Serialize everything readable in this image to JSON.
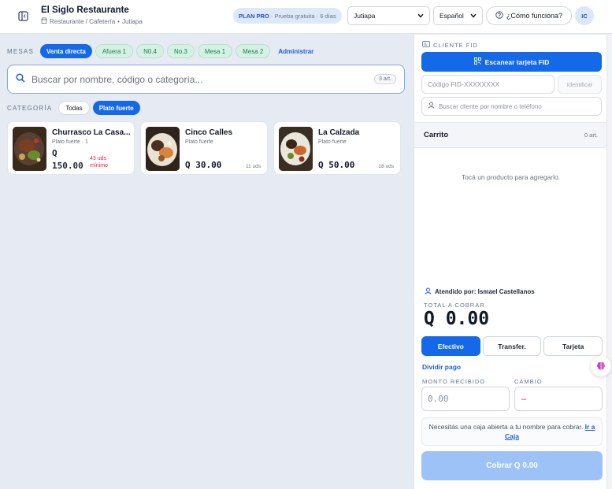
{
  "header": {
    "title": "El Siglo Restaurante",
    "subtitle_type": "Restaurante / Cafetería",
    "subtitle_sep": "•",
    "subtitle_location": "Jutiapa",
    "plan_name": "PLAN PRO",
    "plan_detail": "· Prueba gratuita · 6 días",
    "branch_select": "Jutiapa",
    "language_select": "Español",
    "help_label": "¿Cómo funciona?",
    "avatar_initials": "IC"
  },
  "mesas": {
    "label": "MESAS",
    "items": [
      {
        "label": "Venta directa",
        "style": "active"
      },
      {
        "label": "Afuera 1",
        "style": "green"
      },
      {
        "label": "N0.4",
        "style": "green"
      },
      {
        "label": "No.3",
        "style": "green"
      },
      {
        "label": "Mesa 1",
        "style": "green"
      },
      {
        "label": "Mesa 2",
        "style": "green"
      }
    ],
    "manage_link": "Administrar"
  },
  "search": {
    "placeholder": "Buscar por nombre, código o categoría...",
    "count": "3 art."
  },
  "categories": {
    "label": "CATEGORÍA",
    "items": [
      {
        "label": "Todas",
        "active": false
      },
      {
        "label": "Plato fuerte",
        "active": true
      }
    ]
  },
  "products": [
    {
      "name": "Churrasco La Casa...",
      "category": "Plato fuerte · 1",
      "currency": "Q",
      "price": "150.00",
      "stock": "43 uds ·",
      "stock_note": "mínimo"
    },
    {
      "name": "Cinco Calles",
      "category": "Plato fuerte",
      "price": "Q 30.00",
      "stock": "11 uds"
    },
    {
      "name": "La Calzada",
      "category": "Plato fuerte",
      "price": "Q 50.00",
      "stock": "18 uds"
    }
  ],
  "fid": {
    "label": "CLIENTE FID",
    "scan_button": "Escanear tarjeta FID",
    "code_placeholder": "Código FID-XXXXXXXX",
    "identify_button": "Identificar",
    "customer_placeholder": "Buscar cliente por nombre o teléfono"
  },
  "cart": {
    "title": "Carrito",
    "count": "0 art.",
    "empty_message": "Tocá un producto para agregarlo."
  },
  "checkout": {
    "attended_by": "Atendido por: Ismael Castellanos",
    "total_label": "TOTAL A COBRAR",
    "total_value": "Q 0.00",
    "pay_methods": [
      "Efectivo",
      "Transfer.",
      "Tarjeta"
    ],
    "split_link": "Dividir pago",
    "received_label": "MONTO RECIBIDO",
    "received_placeholder": "0.00",
    "change_label": "CAMBIO",
    "change_value": "–",
    "notice_text": "Necesitás una caja abierta a tu nombre para cobrar.",
    "notice_link": "Ir a Caja",
    "charge_button": "Cobrar Q 0.00"
  },
  "colors": {
    "accent": "#1469e8",
    "green_chip": "#d6f1e4",
    "danger": "#e11d48",
    "charge_disabled": "#9cc2f7"
  }
}
